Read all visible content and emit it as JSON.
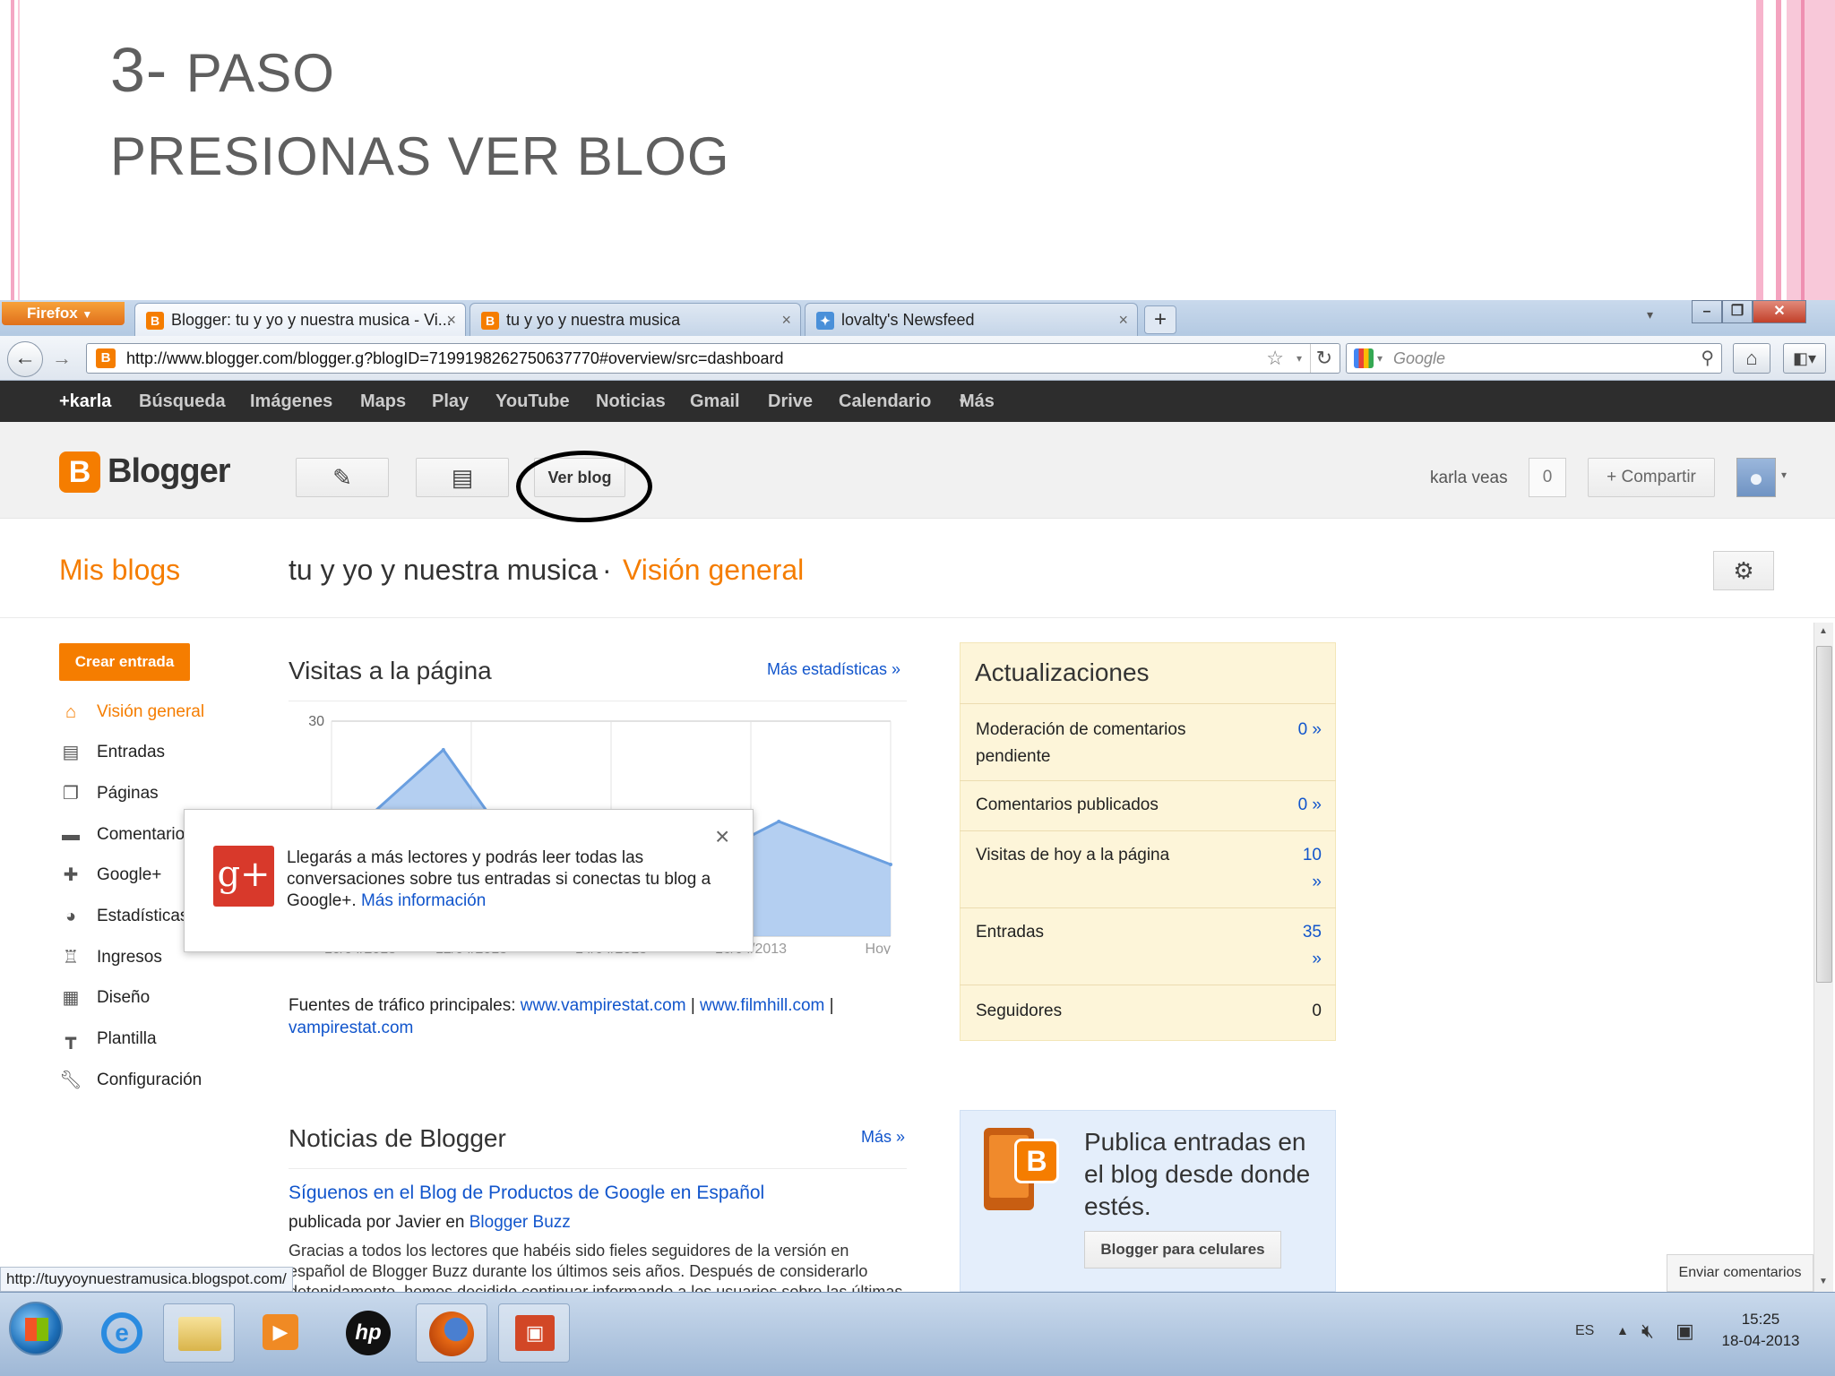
{
  "slide": {
    "title_line1_num": "3-",
    "title_line1_word": "PASO",
    "title_line2": "PRESIONAS VER BLOG"
  },
  "browser": {
    "menu_button": "Firefox",
    "tabs": [
      {
        "label": "Blogger: tu y yo y nuestra musica - Vi...",
        "active": true
      },
      {
        "label": "tu y yo y nuestra musica",
        "active": false
      },
      {
        "label": "lovalty's Newsfeed",
        "active": false
      }
    ],
    "new_tab": "+",
    "url": "http://www.blogger.com/blogger.g?blogID=7199198262750637770#overview/src=dashboard",
    "search_placeholder": "Google",
    "status_url": "http://tuyyoynuestramusica.blogspot.com/"
  },
  "google_bar": [
    "+karla",
    "Búsqueda",
    "Imágenes",
    "Maps",
    "Play",
    "YouTube",
    "Noticias",
    "Gmail",
    "Drive",
    "Calendario",
    "Más"
  ],
  "blogger": {
    "logo": "Blogger",
    "view_blog": "Ver blog",
    "user_name": "karla veas",
    "notif_count": "0",
    "share": "Compartir",
    "my_blogs": "Mis blogs",
    "blog_title": "tu y yo y nuestra musica",
    "separator": "·",
    "section": "Visión general",
    "new_post": "Crear entrada",
    "sidebar": [
      "Visión general",
      "Entradas",
      "Páginas",
      "Comentarios",
      "Google+",
      "Estadísticas",
      "Ingresos",
      "Diseño",
      "Plantilla",
      "Configuración"
    ],
    "stats": {
      "title": "Visitas a la página",
      "more": "Más estadísticas »",
      "traffic_label": "Fuentes de tráfico principales:",
      "traffic_1": "www.vampirestat.com",
      "traffic_sep1": "|",
      "traffic_2": "www.filmhill.com",
      "traffic_sep2": "|",
      "traffic_3": "vampirestat.com"
    },
    "popup": {
      "text": "Llegarás a más lectores y podrás leer todas las conversaciones sobre tus entradas si conectas tu blog a Google+.",
      "link": "Más información",
      "close": "×",
      "icon": "g+"
    },
    "updates": {
      "title": "Actualizaciones",
      "rows": [
        {
          "label": "Moderación de comentarios pendiente",
          "value": "0 »"
        },
        {
          "label": "Comentarios publicados",
          "value": "0 »"
        },
        {
          "label": "Visitas de hoy a la página",
          "value": "10 »"
        },
        {
          "label": "Entradas",
          "value": "35 »"
        },
        {
          "label": "Seguidores",
          "value": "0"
        }
      ]
    },
    "news": {
      "title": "Noticias de Blogger",
      "more": "Más »",
      "headline": "Síguenos en el Blog de Productos de Google en Español",
      "byline_prefix": "publicada por Javier en",
      "byline_link": "Blogger Buzz",
      "body": "Gracias a todos los lectores que habéis sido fieles seguidores de la versión en español de Blogger Buzz durante los últimos seis años. Después de considerarlo detenidamente, hemos decidido continuar informando a los usuarios sobre las últimas novedades"
    },
    "mobile": {
      "text": "Publica entradas en el blog desde donde estés.",
      "button": "Blogger para celulares"
    },
    "feedback": "Enviar comentarios"
  },
  "chart_data": {
    "type": "area",
    "title": "Visitas a la página",
    "x": [
      "10/04/2013",
      "12/04/2013",
      "14/04/2013",
      "16/04/2013",
      "Hoy"
    ],
    "y_ticks": [
      30
    ],
    "ylim": [
      0,
      30
    ],
    "series": [
      {
        "values": [
          12,
          26,
          4,
          8,
          16,
          10
        ]
      }
    ],
    "grid": true
  },
  "taskbar": {
    "lang": "ES",
    "time": "15:25",
    "date": "18-04-2013"
  },
  "colors": {
    "blogger_orange": "#f57d00",
    "link_blue": "#1155cc",
    "chart_fill": "#a7c7ee",
    "chart_line": "#6a9fe0",
    "updates_bg": "#fdf5d9",
    "mobile_bg": "#e4eefb"
  }
}
